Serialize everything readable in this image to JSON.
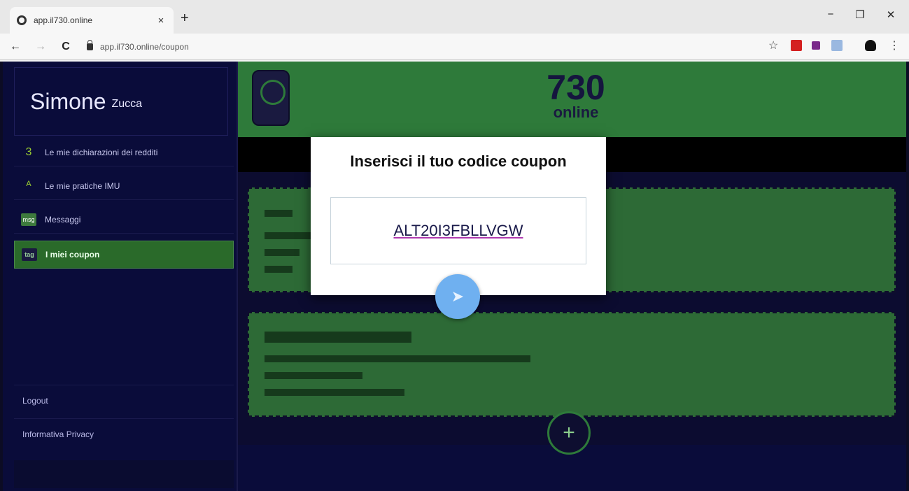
{
  "browser": {
    "tab_title": "app.il730.online",
    "tab_close": "×",
    "new_tab": "+",
    "url": "app.il730.online/coupon",
    "back": "←",
    "forward": "→",
    "reload": "C",
    "minimize": "−",
    "restore": "❐",
    "close": "✕",
    "star": "☆",
    "menu": "⋮"
  },
  "sidebar": {
    "user_first": "Simone",
    "user_last": "Zucca",
    "items": [
      {
        "label": "Le mie dichiarazioni dei redditi",
        "icon": "3"
      },
      {
        "label": "Le mie pratiche IMU",
        "icon": "ᴬ"
      },
      {
        "label": "Messaggi",
        "icon": "msg"
      },
      {
        "label": "I miei coupon",
        "icon": "tag"
      }
    ],
    "logout": "Logout",
    "privacy": "Informativa Privacy"
  },
  "header": {
    "logo_number": "730",
    "logo_word": "online"
  },
  "dialog": {
    "title": "Inserisci il tuo codice coupon",
    "coupon_value": "ALT20I3FBLLVGW",
    "submit_icon": "➤"
  },
  "fab": {
    "label": "+"
  }
}
